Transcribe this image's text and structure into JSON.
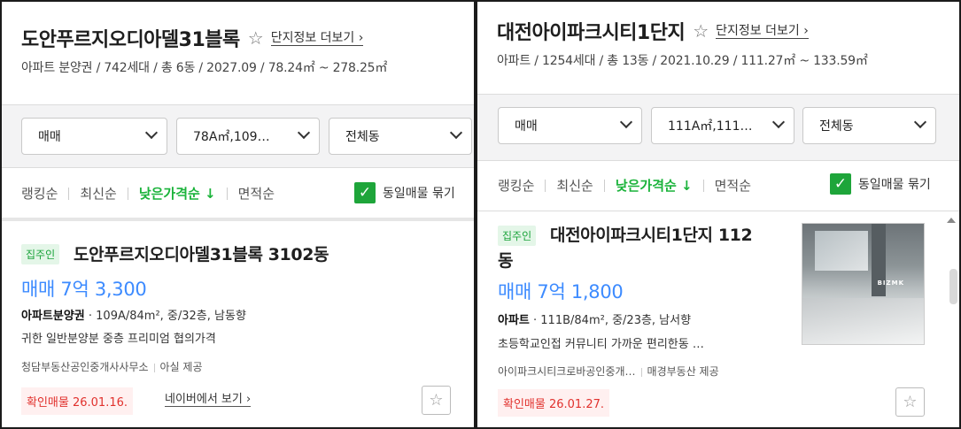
{
  "left": {
    "complex_name": "도안푸르지오디아델31블록",
    "more_link": "단지정보 더보기",
    "meta": "아파트 분양권 / 742세대 / 총 6동 / 2027.09 / 78.24㎡ ~ 278.25㎡",
    "filters": {
      "trade": "매매",
      "area": "78A㎡,109…",
      "building": "전체동"
    },
    "sort": {
      "ranking": "랭킹순",
      "latest": "최신순",
      "lowest_price": "낮은가격순 ↓",
      "area": "면적순",
      "group_label": "동일매물 묶기"
    },
    "listing": {
      "badge": "집주인",
      "title": "도안푸르지오디아델31블록 3102동",
      "price": "매매 7억 3,300",
      "type": "아파트분양권",
      "spec": " · 109A/84m², 중/32층, 남동향",
      "desc": "귀한 일반분양분 중층 프리미엄 협의가격",
      "agent": "청담부동산공인중개사사무소",
      "provider": "아실 제공",
      "confirm": "확인매물 26.01.16.",
      "naver_link": "네이버에서 보기"
    }
  },
  "right": {
    "complex_name": "대전아이파크시티1단지",
    "more_link": "단지정보 더보기",
    "meta": "아파트 / 1254세대 / 총 13동 / 2021.10.29 / 111.27㎡ ~ 133.59㎡",
    "filters": {
      "trade": "매매",
      "area": "111A㎡,111…",
      "building": "전체동"
    },
    "sort": {
      "ranking": "랭킹순",
      "latest": "최신순",
      "lowest_price": "낮은가격순 ↓",
      "area": "면적순",
      "group_label": "동일매물 묶기"
    },
    "listing": {
      "badge": "집주인",
      "title_line1": "대전아이파크시티1단지 112",
      "title_line2": "동",
      "price": "매매 7억 1,800",
      "type": "아파트",
      "spec": " · 111B/84m², 중/23층, 남서향",
      "desc": "초등학교인접 커뮤니티 가까운 편리한동 …",
      "agent": "아이파크시티크로바공인중개…",
      "provider": "매경부동산 제공",
      "confirm": "확인매물 26.01.27.",
      "photo_watermark": "BIZMK"
    }
  },
  "icons": {
    "star_outline": "☆",
    "chevron_right": "›",
    "check": "✓"
  },
  "colors": {
    "accent_green": "#1bb33b",
    "price_blue": "#3d8bff",
    "confirm_red": "#e1312d",
    "checkbox_green": "#1ea53a"
  }
}
